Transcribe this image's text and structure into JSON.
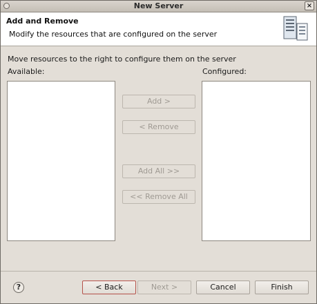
{
  "window": {
    "title": "New Server"
  },
  "banner": {
    "title": "Add and Remove",
    "description": "Modify the resources that are configured on the server"
  },
  "main": {
    "instruction": "Move resources to the right to configure them on the server",
    "available_label": "Available:",
    "configured_label": "Configured:",
    "available_items": [],
    "configured_items": []
  },
  "buttons": {
    "add": "Add >",
    "remove": "< Remove",
    "add_all": "Add All >>",
    "remove_all": "<< Remove All"
  },
  "footer": {
    "back": "< Back",
    "next": "Next >",
    "cancel": "Cancel",
    "finish": "Finish"
  },
  "icons": {
    "help": "help-icon",
    "banner": "server-icon",
    "close": "close-icon"
  }
}
